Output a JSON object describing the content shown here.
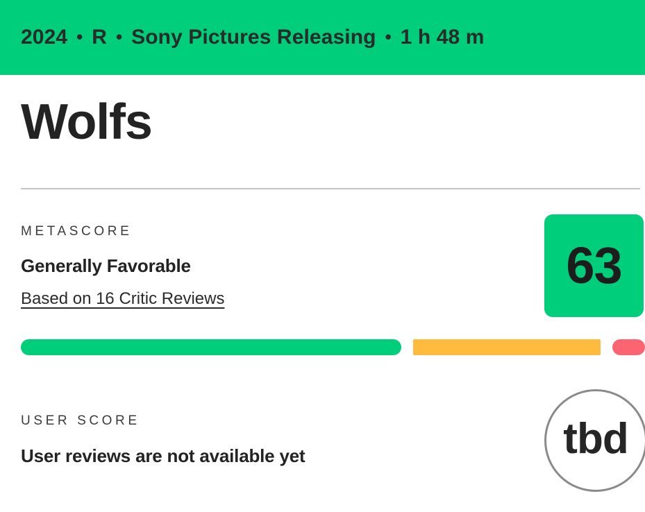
{
  "header": {
    "items": [
      "2024",
      "R",
      "Sony Pictures Releasing",
      "1 h 48 m"
    ],
    "separator": "•",
    "background_color": "#00ce7a",
    "text_color": "#2a2a2a"
  },
  "title": {
    "text": "Wolfs"
  },
  "metascore": {
    "label": "METASCORE",
    "description": "Generally Favorable",
    "review_link": "Based on 16 Critic Reviews",
    "value": "63",
    "badge_color": "#00ce7a",
    "distribution": {
      "positive_color": "#00ce7a",
      "mixed_color": "#ffbb3d",
      "negative_color": "#fb6572",
      "positive_pct": 61,
      "mixed_pct": 30,
      "negative_pct": 5
    }
  },
  "userscore": {
    "label": "USER SCORE",
    "description": "User reviews are not available yet",
    "value": "tbd",
    "border_color": "#8a8a8a"
  }
}
